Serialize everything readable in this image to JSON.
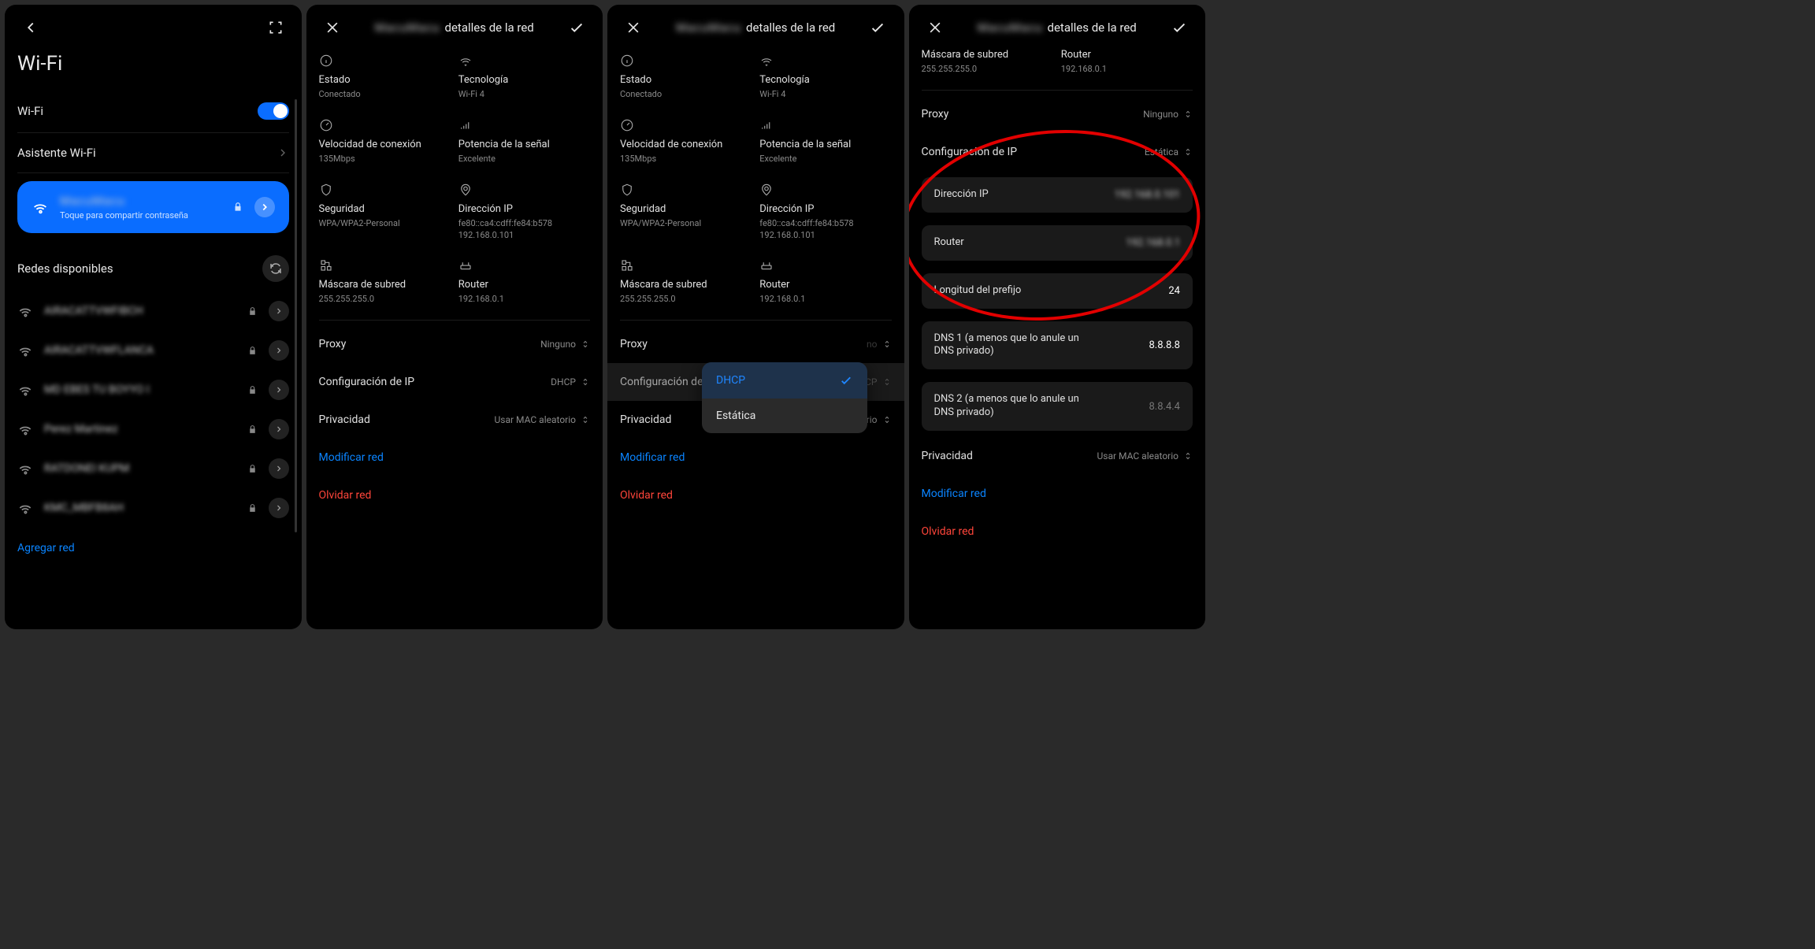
{
  "panel1": {
    "title": "Wi-Fi",
    "toggle_label": "Wi-Fi",
    "assistant_label": "Asistente Wi-Fi",
    "connected": {
      "ssid_blur": "MacuMacu",
      "hint": "Toque para compartir contraseña"
    },
    "available_title": "Redes disponibles",
    "networks": [
      "AIRACATTVWFIBCH",
      "AIRACATTVWFLANCA",
      "MD EBES TU BOYYO I",
      "Perez Martinez",
      "RATDONEI KUPM",
      "KMC_MBFB8AH"
    ],
    "add_network": "Agregar red"
  },
  "details_title_suffix": "detalles de la red",
  "details_title_blur": "MacuMacu",
  "detail_cells": {
    "estado": {
      "label": "Estado",
      "value": "Conectado"
    },
    "tecnologia": {
      "label": "Tecnología",
      "value": "Wi-Fi 4"
    },
    "velocidad": {
      "label": "Velocidad de conexión",
      "value": "135Mbps"
    },
    "potencia": {
      "label": "Potencia de la señal",
      "value": "Excelente"
    },
    "seguridad": {
      "label": "Seguridad",
      "value": "WPA/WPA2-Personal"
    },
    "direccion_ip": {
      "label": "Dirección IP",
      "value": "fe80::ca4:cdff:fe84:b578\n192.168.0.101"
    },
    "mascara": {
      "label": "Máscara de subred",
      "value": "255.255.255.0"
    },
    "router": {
      "label": "Router",
      "value": "192.168.0.1"
    }
  },
  "settings_rows": {
    "proxy": {
      "label": "Proxy",
      "value": "Ninguno"
    },
    "ipconf": {
      "label": "Configuración de IP",
      "value_dhcp": "DHCP",
      "value_static": "Estática"
    },
    "privacidad": {
      "label": "Privacidad",
      "value": "Usar MAC aleatorio"
    }
  },
  "actions": {
    "modificar": "Modificar red",
    "olvidar": "Olvidar red"
  },
  "popup": {
    "dhcp": "DHCP",
    "estatica": "Estática"
  },
  "panel4": {
    "mascara": {
      "label": "Máscara de subred",
      "value": "255.255.255.0"
    },
    "router_top": {
      "label": "Router",
      "value": "192.168.0.1"
    },
    "proxy": {
      "label": "Proxy",
      "value": "Ninguno"
    },
    "ipconf": {
      "label": "Configuración de IP",
      "value": "Estática"
    },
    "direccion_ip": {
      "label": "Dirección IP",
      "value": "192.168.0.101"
    },
    "router_field": {
      "label": "Router",
      "value": "192.168.0.1"
    },
    "prefijo": {
      "label": "Longitud del prefijo",
      "value": "24"
    },
    "dns1": {
      "label": "DNS 1 (a menos que lo anule un DNS privado)",
      "value": "8.8.8.8"
    },
    "dns2": {
      "label": "DNS 2 (a menos que lo anule un DNS privado)",
      "value": "8.8.4.4"
    },
    "privacidad": {
      "label": "Privacidad",
      "value": "Usar MAC aleatorio"
    }
  }
}
